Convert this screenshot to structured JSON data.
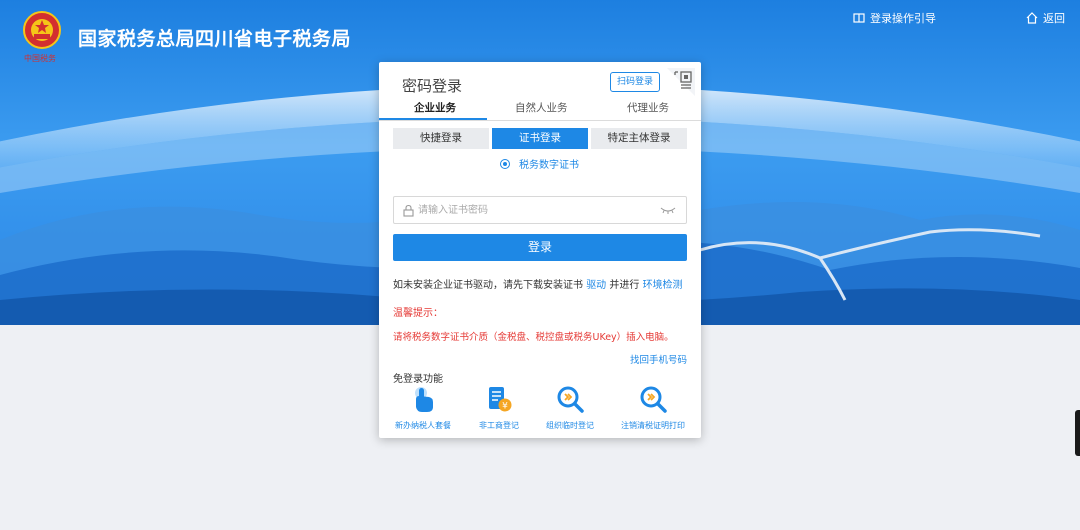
{
  "header": {
    "site_title": "国家税务总局四川省电子税务局",
    "guide_link": "登录操作引导",
    "back_link": "返回"
  },
  "login_card": {
    "title": "密码登录",
    "qr_login_button": "扫码登录",
    "business_tabs": [
      {
        "label": "企业业务",
        "active": true
      },
      {
        "label": "自然人业务",
        "active": false
      },
      {
        "label": "代理业务",
        "active": false
      }
    ],
    "login_type_tabs": [
      {
        "label": "快捷登录",
        "active": false
      },
      {
        "label": "证书登录",
        "active": true
      },
      {
        "label": "特定主体登录",
        "active": false
      }
    ],
    "certificate_option": "税务数字证书",
    "password_placeholder": "请输入证书密码",
    "login_button": "登录",
    "driver_notice": {
      "prefix": "如未安装企业证书驱动，请先下载安装证书",
      "driver_link": "驱动",
      "middle": "并进行",
      "env_link": "环境检测"
    },
    "tip_title": "温馨提示：",
    "tip_text": "请将税务数字证书介质（金税盘、税控盘或税务UKey）插入电脑。",
    "find_phone_link": "找回手机号码",
    "free_login_title": "免登录功能",
    "free_functions": [
      {
        "label": "新办纳税人套餐",
        "icon": "hand-pointer-icon"
      },
      {
        "label": "非工商登记",
        "icon": "document-yuan-icon"
      },
      {
        "label": "组织临时登记",
        "icon": "magnifier-icon"
      },
      {
        "label": "注销清税证明打印",
        "icon": "magnifier-icon"
      }
    ]
  },
  "colors": {
    "primary": "#1e88e5",
    "warning": "#e53935",
    "page_background": "#eef0f4"
  }
}
